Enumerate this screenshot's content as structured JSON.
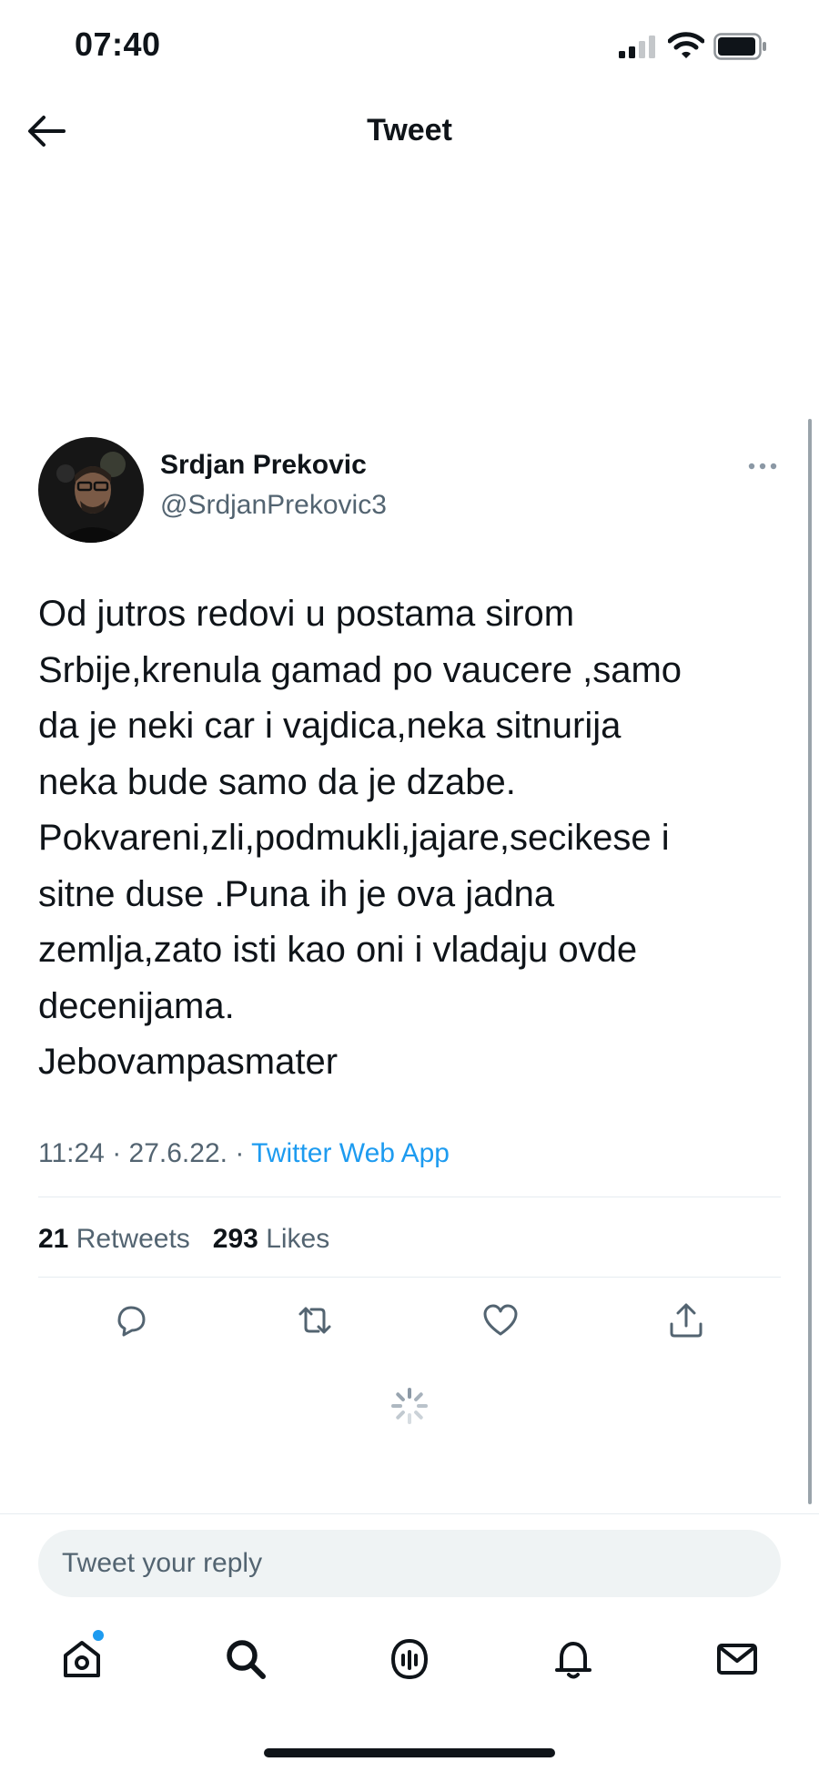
{
  "status_bar": {
    "time": "07:40"
  },
  "header": {
    "title": "Tweet"
  },
  "author": {
    "name": "Srdjan Prekovic",
    "handle": "@SrdjanPrekovic3"
  },
  "tweet": {
    "text": "Od jutros redovi u postama sirom\nSrbije,krenula gamad po vaucere ,samo\nda je neki car i vajdica,neka sitnurija\nneka bude samo da je dzabe.\nPokvareni,zli,podmukli,jajare,secikese i\nsitne duse .Puna ih je ova jadna\nzemlja,zato isti kao oni i vladaju ovde\ndecenijama.\nJebovampasmater",
    "time": "11:24",
    "date": "27.6.22.",
    "source": "Twitter Web App",
    "retweets_count": "21",
    "retweets_label": "Retweets",
    "likes_count": "293",
    "likes_label": "Likes"
  },
  "reply": {
    "placeholder": "Tweet your reply"
  },
  "colors": {
    "accent": "#1d9bf0",
    "text": "#0f1419",
    "secondary": "#536471"
  }
}
